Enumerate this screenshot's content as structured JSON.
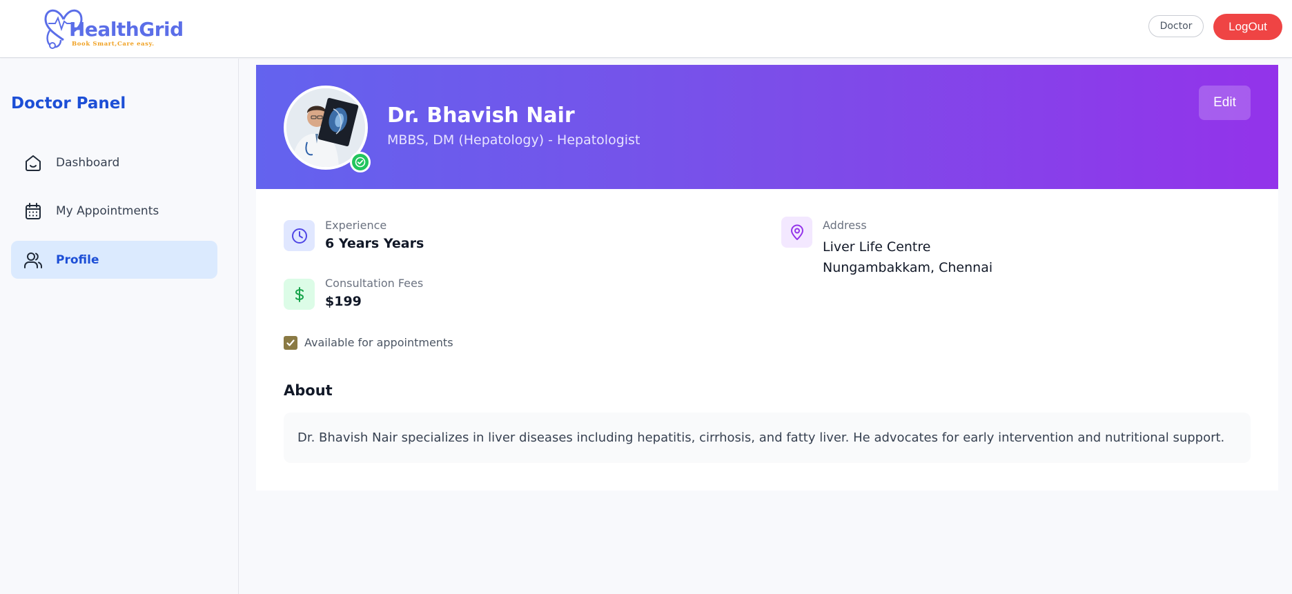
{
  "brand": {
    "name": "HealthGrid",
    "tagline": "Book Smart,Care easy."
  },
  "header": {
    "role_badge": "Doctor",
    "logout_label": "LogOut"
  },
  "sidebar": {
    "title": "Doctor Panel",
    "items": [
      {
        "label": "Dashboard",
        "icon": "home-icon",
        "active": false
      },
      {
        "label": "My Appointments",
        "icon": "calendar-icon",
        "active": false
      },
      {
        "label": "Profile",
        "icon": "users-icon",
        "active": true
      }
    ]
  },
  "profile": {
    "name": "Dr. Bhavish Nair",
    "qualification": "MBBS, DM (Hepatology) - Hepatologist",
    "edit_label": "Edit",
    "verified_icon": "check-circle-icon",
    "experience": {
      "label": "Experience",
      "value": "6 Years Years",
      "icon": "clock-icon"
    },
    "fees": {
      "label": "Consultation Fees",
      "value": "$199",
      "icon": "dollar-icon"
    },
    "address": {
      "label": "Address",
      "line1": "Liver Life Centre",
      "line2": "Nungambakkam, Chennai",
      "icon": "map-pin-icon"
    },
    "availability": {
      "label": "Available for appointments",
      "checked": true
    },
    "about": {
      "title": "About",
      "text": "Dr. Bhavish Nair specializes in liver diseases including hepatitis, cirrhosis, and fatty liver. He advocates for early intervention and nutritional support."
    }
  },
  "colors": {
    "brand": "#5b6ee8",
    "accent": "#1d4fd6",
    "logout": "#ef4444",
    "banner_start": "#6363ee",
    "banner_end": "#9333ea",
    "verified": "#22c55e"
  }
}
